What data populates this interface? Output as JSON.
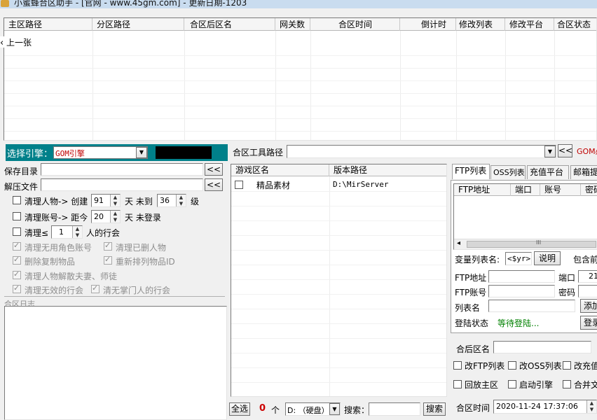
{
  "title": "小蜜蜂合区助手 - [官网 - www.45gm.com] - 更新日期-1203",
  "top_table": {
    "columns": [
      "主区路径",
      "分区路径",
      "合区后区名",
      "网关数",
      "合区时间",
      "倒计时",
      "修改列表",
      "修改平台",
      "合区状态"
    ],
    "row": "上一张"
  },
  "engine": {
    "label": "选择引擎：",
    "value": "GOM引擎"
  },
  "merge_tool": {
    "label": "合区工具路径",
    "value": "",
    "back": "<<",
    "right_text": "GOM必"
  },
  "save_dir": {
    "label": "保存目录",
    "value": "",
    "btn": "<<"
  },
  "unzip_file": {
    "label": "解压文件",
    "value": "",
    "btn": "<<"
  },
  "opt1": {
    "a": "清理人物-> 创建",
    "days": "91",
    "b": "天  未到",
    "level": "36",
    "c": "级"
  },
  "opt2": {
    "a": "清理账号-> 距今",
    "days": "20",
    "b": "天  未登录"
  },
  "opt3": {
    "a": "清理≤",
    "count": "1",
    "b": "人的行会"
  },
  "dis_opts": {
    "a": "清理无用角色账号",
    "b": "清理已删人物",
    "c": "删除复制物品",
    "d": "重新排列物品ID",
    "e": "清理人物解散夫妻、师徒",
    "f": "清理无效的行会",
    "g": "清无掌门人的行会"
  },
  "log_label": "合区日志",
  "game_table": {
    "columns": [
      "游戏区名",
      "版本路径"
    ],
    "rows": [
      {
        "name": "精品素材",
        "path": "D:\\MirServer"
      }
    ]
  },
  "bottom_bar": {
    "select_all": "全选",
    "count": "0",
    "unit": "个",
    "drive": "D: （硬盘）",
    "search_label": "搜索：",
    "search_value": "",
    "search_btn": "搜索"
  },
  "ftp": {
    "tabs": [
      "FTP列表",
      "OSS列表",
      "充值平台",
      "邮箱提"
    ],
    "columns": [
      "FTP地址",
      "端口",
      "账号",
      "密码"
    ],
    "scroll_mid": "III",
    "var_label": "变量列表名:",
    "var_value": "<$yr>",
    "explain_btn": "说明",
    "include_label": "包含前",
    "addr_label": "FTP地址",
    "addr_value": "",
    "port_label": "端口",
    "port_value": "21",
    "acct_label": "FTP账号",
    "acct_value": "",
    "pwd_label": "密码",
    "pwd_value": "",
    "list_label": "列表名",
    "list_value": "",
    "add_btn": "添加",
    "login_label": "登陆状态",
    "login_status": "等待登陆...",
    "login_btn": "登录"
  },
  "merged": {
    "name_label": "合后区名",
    "name_value": "",
    "cb1": "改FTP列表",
    "cb2": "改OSS列表",
    "cb3": "改充值",
    "cb4": "回放主区",
    "cb5": "启动引擎",
    "cb6": "合并文",
    "time_label": "合区时间",
    "time_value": "2020-11-24 17:37:06"
  },
  "colors": {
    "engine_bg": "#00808a",
    "status_green": "#008000",
    "count_red": "#cc0000"
  }
}
